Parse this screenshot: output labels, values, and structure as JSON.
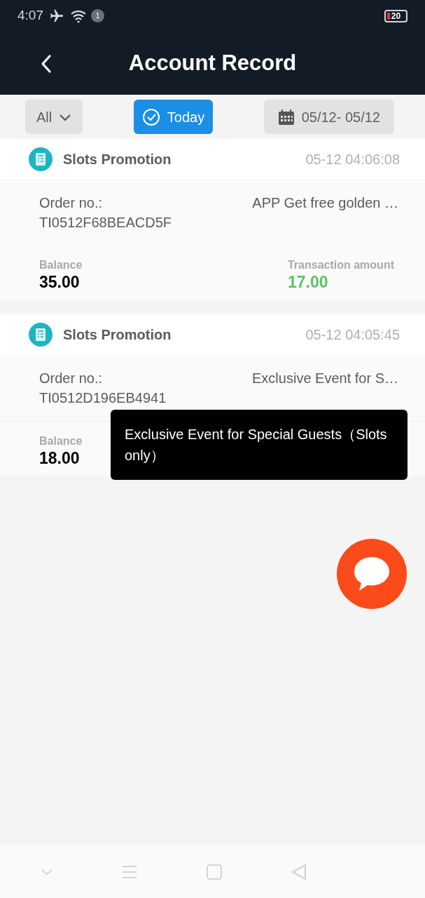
{
  "status_bar": {
    "time": "4:07",
    "notification_count": "1",
    "battery": "20"
  },
  "header": {
    "title": "Account Record"
  },
  "filters": [
    {
      "kind": "dropdown",
      "label": "All",
      "selected": false
    },
    {
      "kind": "toggle",
      "label": "Today",
      "selected": true
    },
    {
      "kind": "date",
      "label": "05/12- 05/12",
      "selected": false
    }
  ],
  "records": [
    {
      "title": "Slots Promotion",
      "time": "05-12 04:06:08",
      "order_label": "Order no.:",
      "order_no": "TI0512F68BEACD5F",
      "description": "APP Get free golden …",
      "balance_label": "Balance",
      "balance": "35.00",
      "amount_label": "Transaction amount",
      "amount": "17.00"
    },
    {
      "title": "Slots Promotion",
      "time": "05-12 04:05:45",
      "order_label": "Order no.:",
      "order_no": "TI0512D196EB4941",
      "description": "Exclusive Event for S…",
      "balance_label": "Balance",
      "balance": "18.00"
    }
  ],
  "tooltip": {
    "text": "Exclusive Event for Special Guests（Slots only）"
  }
}
